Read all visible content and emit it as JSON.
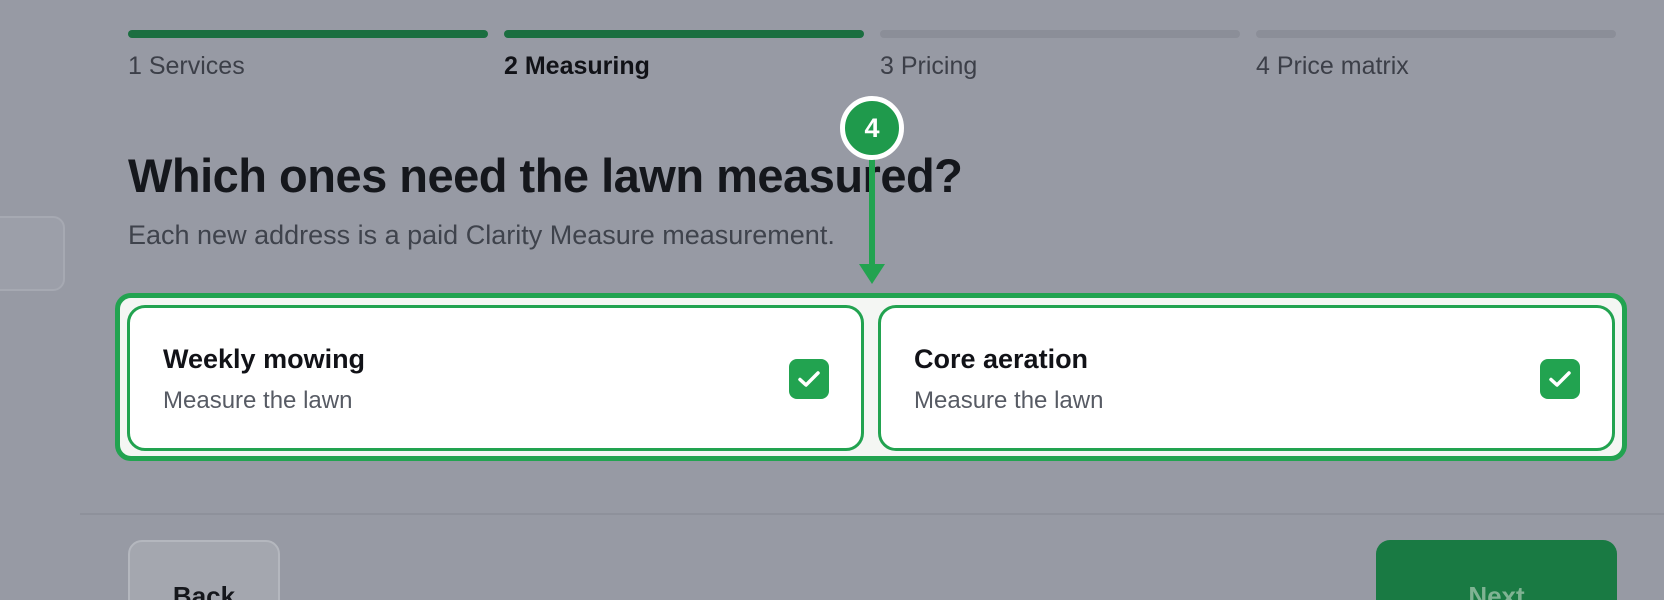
{
  "stepper": {
    "steps": [
      {
        "label": "1 Services",
        "state": "complete"
      },
      {
        "label": "2 Measuring",
        "state": "active"
      },
      {
        "label": "3 Pricing",
        "state": "upcoming"
      },
      {
        "label": "4 Price matrix",
        "state": "upcoming"
      }
    ]
  },
  "header": {
    "title": "Which ones need the lawn measured?",
    "subtitle": "Each new address is a paid Clarity Measure measurement."
  },
  "options": [
    {
      "title": "Weekly mowing",
      "description": "Measure the lawn",
      "checked": true,
      "check_icon": "checkmark-icon"
    },
    {
      "title": "Core aeration",
      "description": "Measure the lawn",
      "checked": true,
      "check_icon": "checkmark-icon"
    }
  ],
  "annotation": {
    "number": "4",
    "icon": "arrow-down-icon"
  },
  "footer": {
    "back_label": "Back",
    "next_label": "Next"
  },
  "colors": {
    "accent_green": "#22a350",
    "progress_complete": "#1b6e40",
    "progress_upcoming": "#8b8e98",
    "next_button": "#197a43",
    "overlay": "#979aa4"
  }
}
